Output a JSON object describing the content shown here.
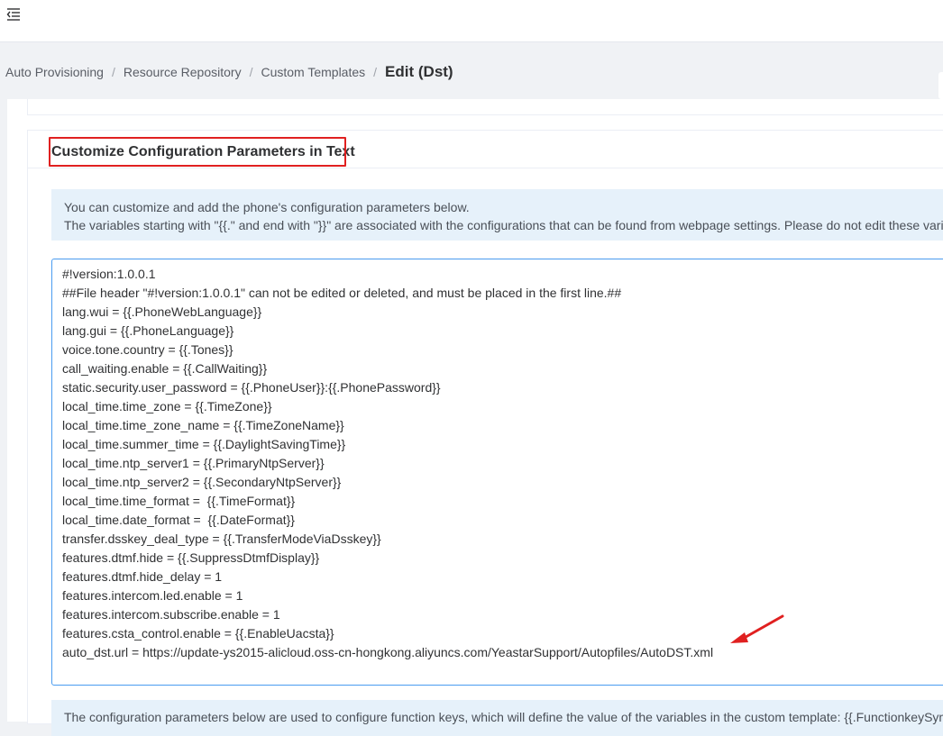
{
  "breadcrumb": {
    "items": [
      "Auto Provisioning",
      "Resource Repository",
      "Custom Templates"
    ],
    "separator": "/",
    "current": "Edit (Dst)"
  },
  "section": {
    "title": "Customize Configuration Parameters in Text"
  },
  "info": {
    "line1": "You can customize and add the phone's configuration parameters below.",
    "line2": "The variables starting with \"{{.\" and end with \"}}\" are associated with the configurations that can be found from webpage settings. Please do not edit these vari"
  },
  "editor": {
    "lines": [
      "#!version:1.0.0.1",
      "##File header \"#!version:1.0.0.1\" can not be edited or deleted, and must be placed in the first line.##",
      "lang.wui = {{.PhoneWebLanguage}}",
      "lang.gui = {{.PhoneLanguage}}",
      "voice.tone.country = {{.Tones}}",
      "call_waiting.enable = {{.CallWaiting}}",
      "static.security.user_password = {{.PhoneUser}}:{{.PhonePassword}}",
      "local_time.time_zone = {{.TimeZone}}",
      "local_time.time_zone_name = {{.TimeZoneName}}",
      "local_time.summer_time = {{.DaylightSavingTime}}",
      "local_time.ntp_server1 = {{.PrimaryNtpServer}}",
      "local_time.ntp_server2 = {{.SecondaryNtpServer}}",
      "local_time.time_format =  {{.TimeFormat}}",
      "local_time.date_format =  {{.DateFormat}}",
      "transfer.dsskey_deal_type = {{.TransferModeViaDsskey}}",
      "features.dtmf.hide = {{.SuppressDtmfDisplay}}",
      "features.dtmf.hide_delay = 1",
      "features.intercom.led.enable = 1",
      "features.intercom.subscribe.enable = 1",
      "features.csta_control.enable = {{.EnableUacsta}}",
      "auto_dst.url = https://update-ys2015-alicloud.oss-cn-hongkong.aliyuncs.com/YeastarSupport/Autopfiles/AutoDST.xml",
      "",
      "                    ...   .  .  {{.   ...     .. .}}"
    ]
  },
  "info2": {
    "text": "The configuration parameters below are used to configure function keys, which will define the value of the variables in the custom template: {{.FunctionkeySym"
  },
  "colors": {
    "highlight": "#e02020",
    "editor_border": "#4a9cf0",
    "info_bg": "#e6f1fa"
  }
}
